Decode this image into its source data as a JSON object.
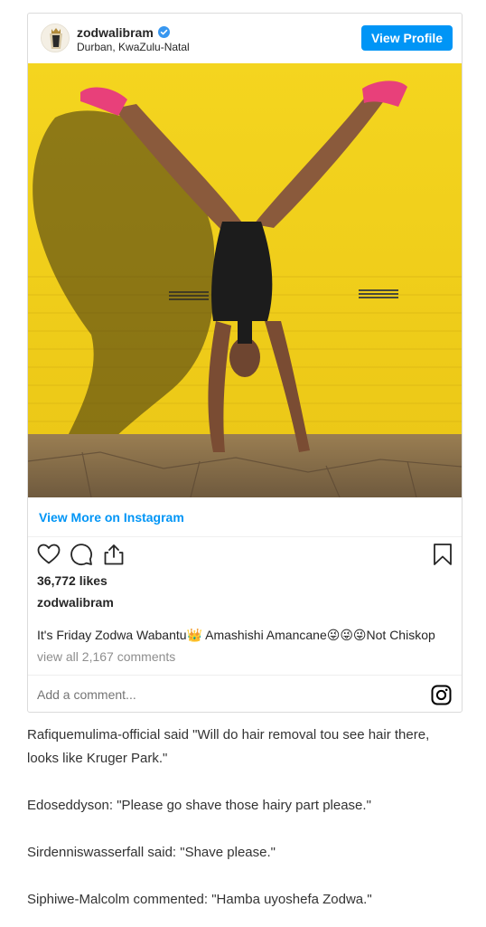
{
  "post": {
    "username": "zodwalibram",
    "location": "Durban, KwaZulu-Natal",
    "view_profile_label": "View Profile",
    "view_more_label": "View More on Instagram",
    "likes": "36,772 likes",
    "caption_user": "zodwalibram",
    "caption_text": "It's Friday Zodwa Wabantu👑 Amashishi Amancane😜😜😜Not Chiskop",
    "comments_link": "view all 2,167 comments",
    "add_comment_placeholder": "Add a comment...",
    "icons": [
      "verified-badge-icon",
      "heart-icon",
      "comment-icon",
      "share-icon",
      "bookmark-icon",
      "instagram-icon"
    ],
    "colors": {
      "accent": "#0095f6",
      "wall": "#f2d21a",
      "muted": "#8e8e8e"
    }
  },
  "article": {
    "paragraphs": [
      "Rafiquemulima-official said \"Will do hair removal tou see hair there, looks like Kruger Park.\"",
      "Edoseddyson: \"Please go shave those hairy part please.\"",
      "Sirdenniswasserfall said: \"Shave please.\"",
      "Siphiwe-Malcolm commented: \"Hamba uyoshefa Zodwa.\""
    ]
  }
}
